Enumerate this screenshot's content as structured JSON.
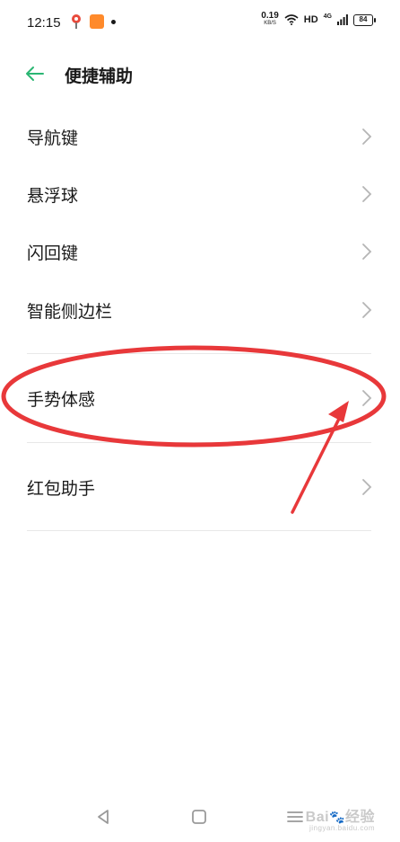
{
  "status_bar": {
    "time": "12:15",
    "net_speed_value": "0.19",
    "net_speed_unit": "KB/S",
    "hd": "HD",
    "signal_label": "4G",
    "battery": "84"
  },
  "header": {
    "title": "便捷辅助",
    "back_icon": "arrow-left-icon"
  },
  "list": {
    "items": [
      {
        "label": "导航键"
      },
      {
        "label": "悬浮球"
      },
      {
        "label": "闪回键"
      },
      {
        "label": "智能侧边栏"
      },
      {
        "label": "手势体感"
      },
      {
        "label": "红包助手"
      }
    ]
  },
  "watermark": {
    "text": "Bai",
    "suffix": "经验",
    "sub": "jingyan.baidu.com"
  },
  "colors": {
    "accent": "#2bb673",
    "annotation": "#e8383a",
    "chevron": "#b5b5b5",
    "divider": "#e8e8e8"
  }
}
